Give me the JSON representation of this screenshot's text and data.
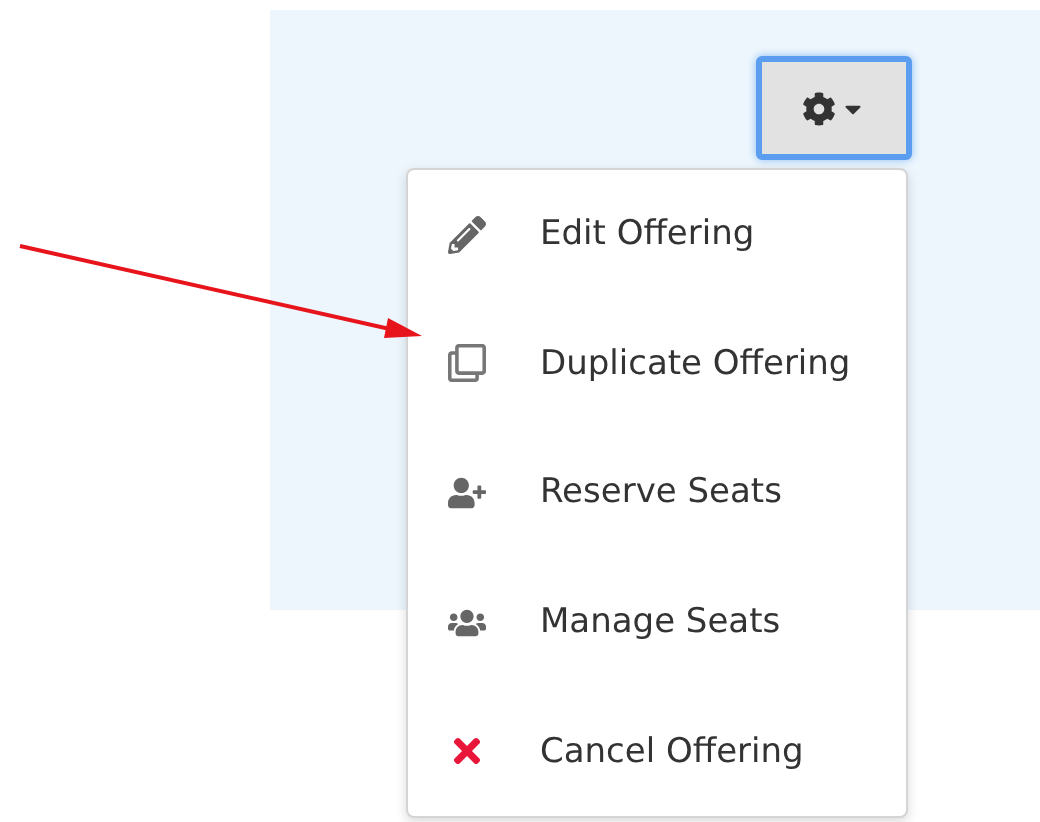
{
  "menu_button": {
    "expanded": true
  },
  "menu": {
    "items": [
      {
        "kind": "edit",
        "label": "Edit Offering"
      },
      {
        "kind": "duplicate",
        "label": "Duplicate Offering"
      },
      {
        "kind": "reserve",
        "label": "Reserve Seats"
      },
      {
        "kind": "manage",
        "label": "Manage Seats"
      },
      {
        "kind": "cancel",
        "label": "Cancel Offering"
      }
    ]
  }
}
